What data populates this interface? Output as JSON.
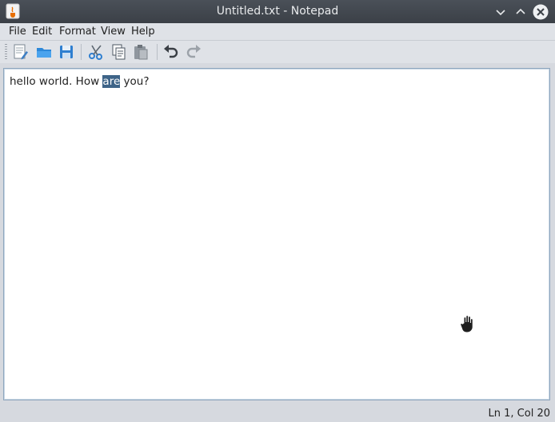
{
  "window": {
    "title": "Untitled.txt - Notepad"
  },
  "menu": {
    "items": [
      "File",
      "Edit",
      "Format",
      "View",
      "Help"
    ]
  },
  "toolbar": {
    "icons": [
      "new-file-icon",
      "open-folder-icon",
      "save-icon",
      "cut-icon",
      "copy-icon",
      "paste-icon",
      "undo-icon",
      "redo-icon"
    ]
  },
  "editor": {
    "text_before": "hello world. How ",
    "selected": "are",
    "text_after": " you?"
  },
  "status": {
    "position": "Ln 1, Col 20"
  },
  "colors": {
    "selection": "#3e6488",
    "titlebar": "#3b4047"
  }
}
